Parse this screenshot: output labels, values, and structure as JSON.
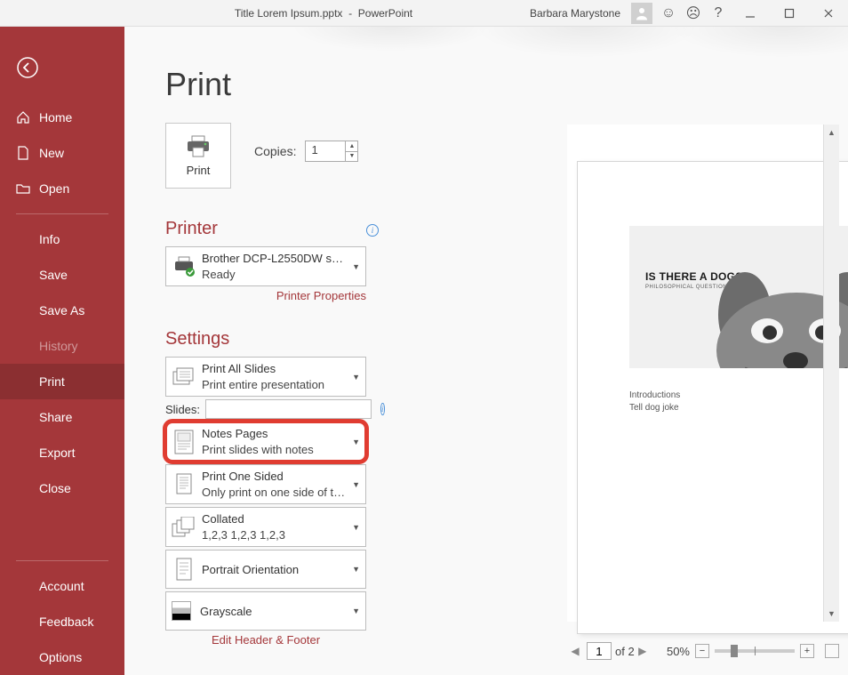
{
  "titlebar": {
    "filename": "Title Lorem Ipsum.pptx",
    "app": "PowerPoint",
    "user": "Barbara Marystone",
    "help": "?"
  },
  "sidebar": {
    "home": "Home",
    "new": "New",
    "open": "Open",
    "info": "Info",
    "save": "Save",
    "save_as": "Save As",
    "history": "History",
    "print": "Print",
    "share": "Share",
    "export": "Export",
    "close": "Close",
    "account": "Account",
    "feedback": "Feedback",
    "options": "Options"
  },
  "print": {
    "page_title": "Print",
    "print_btn": "Print",
    "copies_label": "Copies:",
    "copies_value": "1",
    "printer_hdr": "Printer",
    "printer_name": "Brother DCP-L2550DW serie...",
    "printer_status": "Ready",
    "printer_props": "Printer Properties",
    "settings_hdr": "Settings",
    "slides_label": "Slides:",
    "edit_hf": "Edit Header & Footer",
    "dd_printall": {
      "l1": "Print All Slides",
      "l2": "Print entire presentation"
    },
    "dd_notes": {
      "l1": "Notes Pages",
      "l2": "Print slides with notes"
    },
    "dd_oneside": {
      "l1": "Print One Sided",
      "l2": "Only print on one side of th..."
    },
    "dd_collated": {
      "l1": "Collated",
      "l2": "1,2,3    1,2,3    1,2,3"
    },
    "dd_portrait": {
      "l1": "Portrait Orientation"
    },
    "dd_gray": {
      "l1": "Grayscale"
    }
  },
  "preview": {
    "slide_title": "IS THERE A DOG?",
    "slide_sub": "PHILOSOPHICAL  QUESTIONS",
    "notes_line1": "Introductions",
    "notes_line2": "Tell dog joke",
    "page_number": "1"
  },
  "footer": {
    "page": "1",
    "of_total": "of 2",
    "zoom": "50%"
  }
}
